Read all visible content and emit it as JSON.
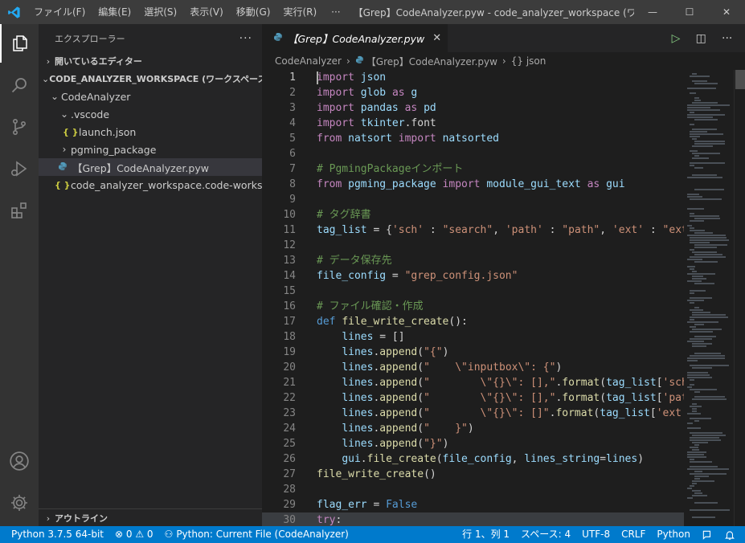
{
  "app": {
    "title": "【Grep】CodeAnalyzer.pyw - code_analyzer_workspace (ワークスペー...",
    "menu": [
      "ファイル(F)",
      "編集(E)",
      "選択(S)",
      "表示(V)",
      "移動(G)",
      "実行(R)"
    ],
    "menu_more": "···",
    "window_controls": {
      "minimize": "—",
      "maximize": "☐",
      "close": "✕"
    }
  },
  "activity_bar": {
    "icons": [
      "explorer-icon",
      "search-icon",
      "source-control-icon",
      "run-debug-icon",
      "extensions-icon",
      "account-icon",
      "settings-gear-icon"
    ]
  },
  "sidebar": {
    "header": "エクスプローラー",
    "header_more": "···",
    "open_editors": "開いているエディター",
    "workspace": "CODE_ANALYZER_WORKSPACE (ワークスペース)",
    "tree": [
      {
        "label": "CodeAnalyzer",
        "chev": "⌄",
        "icon": "",
        "indent": 1
      },
      {
        "label": ".vscode",
        "chev": "⌄",
        "icon": "",
        "indent": 2
      },
      {
        "label": "launch.json",
        "chev": "",
        "icon": "{ }",
        "indent": 3
      },
      {
        "label": "pgming_package",
        "chev": "›",
        "icon": "",
        "indent": 2
      },
      {
        "label": "【Grep】CodeAnalyzer.pyw",
        "chev": "",
        "icon": "py",
        "indent": 2
      },
      {
        "label": "code_analyzer_workspace.code-worksp...",
        "chev": "",
        "icon": "{ }",
        "indent": 1
      }
    ],
    "outline": "アウトライン"
  },
  "editor": {
    "tab_label": "【Grep】CodeAnalyzer.pyw",
    "tab_close": "✕",
    "actions": {
      "run": "▷",
      "split": "◫",
      "more": "···"
    },
    "breadcrumb": [
      "CodeAnalyzer",
      "【Grep】CodeAnalyzer.pyw",
      "{} json"
    ],
    "lines": [
      {
        "n": "1",
        "code": "import json",
        "kind": "code"
      },
      {
        "n": "2",
        "code": "import glob as g",
        "kind": "code"
      },
      {
        "n": "3",
        "code": "import pandas as pd",
        "kind": "code"
      },
      {
        "n": "4",
        "code": "import tkinter.font",
        "kind": "code"
      },
      {
        "n": "5",
        "code": "from natsort import natsorted",
        "kind": "code"
      },
      {
        "n": "6",
        "code": "",
        "kind": "code"
      },
      {
        "n": "7",
        "code": "# PgmingPackageインポート",
        "kind": "comment"
      },
      {
        "n": "8",
        "code": "from pgming_package import module_gui_text as gui",
        "kind": "code"
      },
      {
        "n": "9",
        "code": "",
        "kind": "code"
      },
      {
        "n": "10",
        "code": "# タグ辞書",
        "kind": "comment"
      },
      {
        "n": "11",
        "code": "tag_list = {'sch' : \"search\", 'path' : \"path\", 'ext' : \"ext",
        "kind": "code"
      },
      {
        "n": "12",
        "code": "",
        "kind": "code"
      },
      {
        "n": "13",
        "code": "# データ保存先",
        "kind": "comment"
      },
      {
        "n": "14",
        "code": "file_config = \"grep_config.json\"",
        "kind": "code"
      },
      {
        "n": "15",
        "code": "",
        "kind": "code"
      },
      {
        "n": "16",
        "code": "# ファイル確認・作成",
        "kind": "comment"
      },
      {
        "n": "17",
        "code": "def file_write_create():",
        "kind": "code"
      },
      {
        "n": "18",
        "code": "    lines = []",
        "kind": "code"
      },
      {
        "n": "19",
        "code": "    lines.append(\"{\")",
        "kind": "code"
      },
      {
        "n": "20",
        "code": "    lines.append(\"    \\\"inputbox\\\": {\")",
        "kind": "code"
      },
      {
        "n": "21",
        "code": "    lines.append(\"        \\\"{}\\\": [],\".format(tag_list['sch",
        "kind": "code"
      },
      {
        "n": "22",
        "code": "    lines.append(\"        \\\"{}\\\": [],\".format(tag_list['pat",
        "kind": "code"
      },
      {
        "n": "23",
        "code": "    lines.append(\"        \\\"{}\\\": []\".format(tag_list['ext'",
        "kind": "code"
      },
      {
        "n": "24",
        "code": "    lines.append(\"    }\")",
        "kind": "code"
      },
      {
        "n": "25",
        "code": "    lines.append(\"}\")",
        "kind": "code"
      },
      {
        "n": "26",
        "code": "    gui.file_create(file_config, lines_string=lines)",
        "kind": "code"
      },
      {
        "n": "27",
        "code": "file_write_create()",
        "kind": "code"
      },
      {
        "n": "28",
        "code": "",
        "kind": "code"
      },
      {
        "n": "29",
        "code": "flag_err = False",
        "kind": "code"
      },
      {
        "n": "30",
        "code": "try:",
        "kind": "code"
      }
    ]
  },
  "status_bar": {
    "python": "Python 3.7.5 64-bit",
    "problems": "⊗ 0 ⚠ 0",
    "run_config": "Python: Current File (CodeAnalyzer)",
    "position": "行 1、列 1",
    "spaces": "スペース: 4",
    "encoding": "UTF-8",
    "eol": "CRLF",
    "language": "Python"
  },
  "colors": {
    "keyword": "#569cd6",
    "flow": "#c586c0",
    "string": "#ce9178",
    "func": "#dcdcaa",
    "var": "#9cdcfe",
    "comment": "#6a9955",
    "accent": "#007acc"
  }
}
